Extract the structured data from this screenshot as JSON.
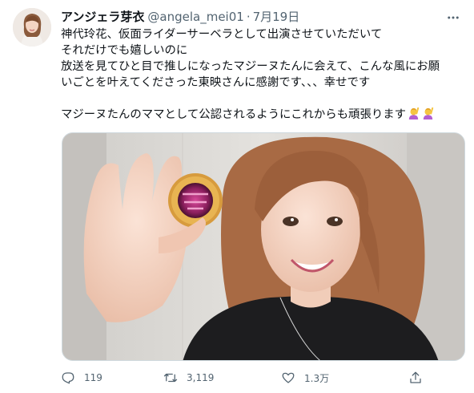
{
  "tweet": {
    "author": {
      "display_name": "アンジェラ芽衣",
      "handle": "@angela_mei01",
      "separator": "·",
      "date": "7月19日"
    },
    "lines": [
      "神代玲花、仮面ライダーサーベラとして出演させていただいて",
      "それだけでも嬉しいのに",
      "放送を見てひと目で推しになったマジーヌたんに会えて、こんな風にお願",
      "いごとを叶えてくださった東映さんに感謝です、、、幸せです",
      "",
      "マジーヌたんのママとして公認されるようにこれからも頑張ります"
    ],
    "emojis": [
      "person-raising-hand-emoji",
      "person-raising-hand-emoji"
    ],
    "media": {
      "description": "photo-woman-holding-medal"
    },
    "actions": {
      "reply": {
        "icon": "reply-icon",
        "count": "119"
      },
      "retweet": {
        "icon": "retweet-icon",
        "count": "3,119"
      },
      "like": {
        "icon": "heart-icon",
        "count": "1.3万"
      },
      "share": {
        "icon": "share-icon"
      }
    }
  },
  "colors": {
    "text": "#0f1419",
    "secondary": "#536471",
    "border": "#cfd9de"
  }
}
